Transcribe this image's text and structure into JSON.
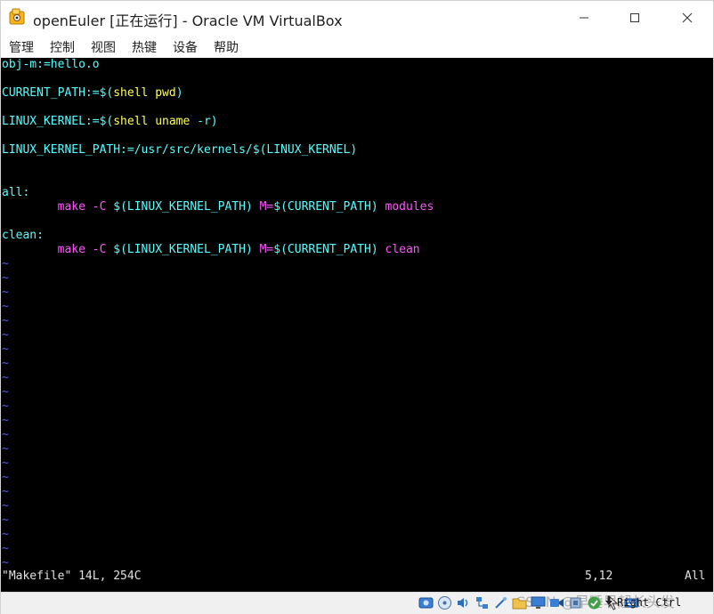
{
  "window": {
    "title": "openEuler [正在运行] - Oracle VM VirtualBox"
  },
  "menubar": {
    "items": [
      "管理",
      "控制",
      "视图",
      "热键",
      "设备",
      "帮助"
    ]
  },
  "terminal": {
    "lines": [
      {
        "segments": [
          [
            "obj-m:=hello.o",
            "cyan"
          ]
        ]
      },
      {
        "segments": []
      },
      {
        "segments": [
          [
            "CURRENT_PATH:=$(",
            "cyan"
          ],
          [
            "shell pwd",
            "yellow"
          ],
          [
            ")",
            "cyan"
          ]
        ]
      },
      {
        "segments": []
      },
      {
        "segments": [
          [
            "LINUX_KERNEL:=$(",
            "cyan"
          ],
          [
            "shell uname",
            "yellow"
          ],
          [
            " -r)",
            "cyan"
          ]
        ]
      },
      {
        "segments": []
      },
      {
        "segments": [
          [
            "LINUX_KERNEL_PATH:=/usr/src/kernels/$(LINUX_KERNEL)",
            "cyan"
          ]
        ]
      },
      {
        "segments": []
      },
      {
        "segments": []
      },
      {
        "segments": [
          [
            "all:",
            "cyan"
          ]
        ]
      },
      {
        "segments": [
          [
            "        ",
            "white"
          ],
          [
            "make",
            "magenta"
          ],
          [
            " ",
            "white"
          ],
          [
            "-C",
            "magenta"
          ],
          [
            " $(LINUX_KERNEL_PATH) ",
            "cyan"
          ],
          [
            "M=",
            "magenta"
          ],
          [
            "$(CURRENT_PATH) ",
            "cyan"
          ],
          [
            "modules",
            "magenta"
          ]
        ]
      },
      {
        "segments": []
      },
      {
        "segments": [
          [
            "clean:",
            "cyan"
          ]
        ]
      },
      {
        "segments": [
          [
            "        ",
            "white"
          ],
          [
            "make",
            "magenta"
          ],
          [
            " ",
            "white"
          ],
          [
            "-C",
            "magenta"
          ],
          [
            " $(LINUX_KERNEL_PATH) ",
            "cyan"
          ],
          [
            "M=",
            "magenta"
          ],
          [
            "$(CURRENT_PATH) ",
            "cyan"
          ],
          [
            "clean",
            "magenta"
          ]
        ]
      }
    ],
    "tilde_char": "~",
    "tilde_count": 22,
    "status_file": "\"Makefile\" 14L, 254C",
    "status_position": "5,12",
    "status_scroll": "All"
  },
  "statusbar": {
    "host_key": "Right Ctrl",
    "watermark": "CSDN @早睡早起长头发"
  },
  "colors": {
    "cyan": "#55ffff",
    "yellow": "#ffff55",
    "magenta": "#ff55ff",
    "tilde": "#5555ff",
    "terminal_bg": "#000000"
  }
}
